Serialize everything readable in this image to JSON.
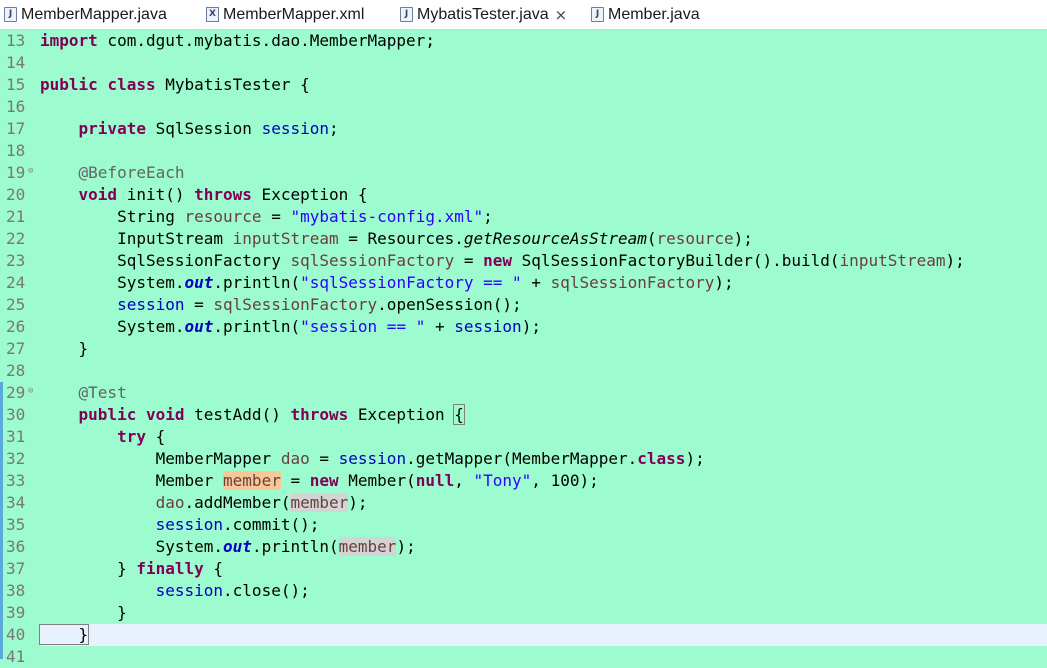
{
  "tabs": [
    {
      "label": "MemberMapper.java",
      "icon": "java-file-icon",
      "active": false
    },
    {
      "label": "MemberMapper.xml",
      "icon": "xml-file-icon",
      "active": false
    },
    {
      "label": "MybatisTester.java",
      "icon": "java-file-icon",
      "active": true,
      "close": "×"
    },
    {
      "label": "Member.java",
      "icon": "java-file-icon",
      "active": false
    }
  ],
  "editor": {
    "line_numbers": [
      "13",
      "14",
      "15",
      "16",
      "17",
      "18",
      "19",
      "20",
      "21",
      "22",
      "23",
      "24",
      "25",
      "26",
      "27",
      "28",
      "29",
      "30",
      "31",
      "32",
      "33",
      "34",
      "35",
      "36",
      "37",
      "38",
      "39",
      "40",
      "41"
    ],
    "tokens": {
      "l13a": "import",
      "l13b": " com.dgut.mybatis.dao.MemberMapper;",
      "l15a": "public",
      "l15b": " ",
      "l15c": "class",
      "l15d": " MybatisTester {",
      "l17a": "    ",
      "l17b": "private",
      "l17c": " SqlSession ",
      "l17d": "session",
      "l17e": ";",
      "l19": "    @BeforeEach",
      "l20a": "    ",
      "l20b": "void",
      "l20c": " init() ",
      "l20d": "throws",
      "l20e": " Exception {",
      "l21a": "        String ",
      "l21b": "resource",
      "l21c": " = ",
      "l21d": "\"mybatis-config.xml\"",
      "l21e": ";",
      "l22a": "        InputStream ",
      "l22b": "inputStream",
      "l22c": " = Resources.",
      "l22d": "getResourceAsStream",
      "l22e": "(",
      "l22f": "resource",
      "l22g": ");",
      "l23a": "        SqlSessionFactory ",
      "l23b": "sqlSessionFactory",
      "l23c": " = ",
      "l23d": "new",
      "l23e": " SqlSessionFactoryBuilder().build(",
      "l23f": "inputStream",
      "l23g": ");",
      "l24a": "        System.",
      "l24b": "out",
      "l24c": ".println(",
      "l24d": "\"sqlSessionFactory == \"",
      "l24e": " + ",
      "l24f": "sqlSessionFactory",
      "l24g": ");",
      "l25a": "        ",
      "l25b": "session",
      "l25c": " = ",
      "l25d": "sqlSessionFactory",
      "l25e": ".openSession();",
      "l26a": "        System.",
      "l26b": "out",
      "l26c": ".println(",
      "l26d": "\"session == \"",
      "l26e": " + ",
      "l26f": "session",
      "l26g": ");",
      "l27": "    }",
      "l29": "    @Test",
      "l30a": "    ",
      "l30b": "public",
      "l30c": " ",
      "l30d": "void",
      "l30e": " testAdd() ",
      "l30f": "throws",
      "l30g": " Exception ",
      "l30h": "{",
      "l31a": "        ",
      "l31b": "try",
      "l31c": " {",
      "l32a": "            MemberMapper ",
      "l32b": "dao",
      "l32c": " = ",
      "l32d": "session",
      "l32e": ".getMapper(MemberMapper.",
      "l32f": "class",
      "l32g": ");",
      "l33a": "            Member ",
      "l33b": "member",
      "l33c": " = ",
      "l33d": "new",
      "l33e": " Member(",
      "l33f": "null",
      "l33g": ", ",
      "l33h": "\"Tony\"",
      "l33i": ", 100);",
      "l34a": "            ",
      "l34b": "dao",
      "l34c": ".addMember(",
      "l34d": "member",
      "l34e": ");",
      "l35a": "            ",
      "l35b": "session",
      "l35c": ".commit();",
      "l36a": "            System.",
      "l36b": "out",
      "l36c": ".println(",
      "l36d": "member",
      "l36e": ");",
      "l37a": "        } ",
      "l37b": "finally",
      "l37c": " {",
      "l38a": "            ",
      "l38b": "session",
      "l38c": ".close();",
      "l39": "        }",
      "l40": "    }"
    }
  },
  "colors": {
    "editor_background": "#9cfbcf",
    "current_line": "#e8f2fe",
    "keyword": "#7f0055",
    "string": "#2a00ff",
    "field": "#0000c0",
    "annotation": "#646464",
    "local_variable": "#6a3e3e",
    "write_occurrence": "#f7c896",
    "read_occurrence": "#d4d4d4"
  },
  "icons": [
    "java-file-icon",
    "xml-file-icon",
    "close-icon",
    "fold-collapse-icon"
  ]
}
